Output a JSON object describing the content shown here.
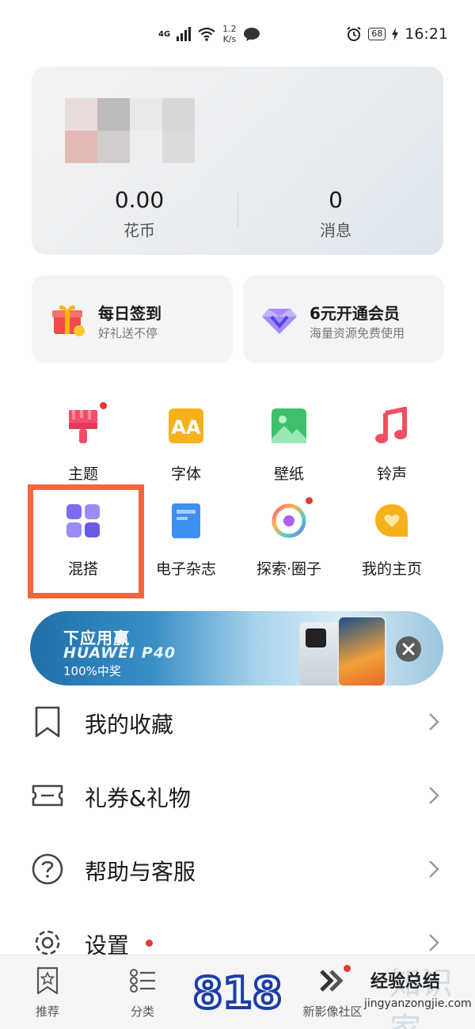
{
  "status_bar": {
    "network": "4G",
    "speed_value": "1.2",
    "speed_unit": "K/s",
    "battery": "68",
    "time": "16:21",
    "icons": [
      "signal-icon",
      "wifi-icon",
      "message-icon",
      "alarm-icon",
      "battery-icon",
      "charging-icon"
    ]
  },
  "profile": {
    "coins_value": "0.00",
    "coins_label": "花币",
    "messages_value": "0",
    "messages_label": "消息"
  },
  "promos": {
    "signin_title": "每日签到",
    "signin_subtitle": "好礼送不停",
    "vip_title": "6元开通会员",
    "vip_subtitle": "海量资源免费使用"
  },
  "grid": {
    "theme": "主题",
    "font": "字体",
    "wallpaper": "壁纸",
    "ringtone": "铃声",
    "mix": "混搭",
    "magazine": "电子杂志",
    "explore": "探索·圈子",
    "homepage": "我的主页"
  },
  "banner": {
    "line1": "下应用赢",
    "line2": "HUAWEI P40",
    "line3": "100%中奖"
  },
  "menu": {
    "favorites": "我的收藏",
    "coupons": "礼券&礼物",
    "help": "帮助与客服",
    "settings": "设置"
  },
  "bottom_nav": {
    "recommend": "推荐",
    "category": "分类",
    "center_logo": "818",
    "community": "新影像社区"
  },
  "watermark": {
    "cn": "经验总结",
    "url": "jingyanzongjie.com",
    "bg": "知识家"
  },
  "colors": {
    "accent_red": "#e53935",
    "highlight_orange": "#f2673f",
    "theme_icon": "#f44d6a",
    "font_icon": "#f6b21c",
    "wallpaper_icon": "#3ec16a",
    "ringtone_icon": "#ef4f5e",
    "mix_icon": "#7b6cf0",
    "magazine_icon": "#3d8ff0",
    "homepage_icon": "#f6b21c"
  }
}
